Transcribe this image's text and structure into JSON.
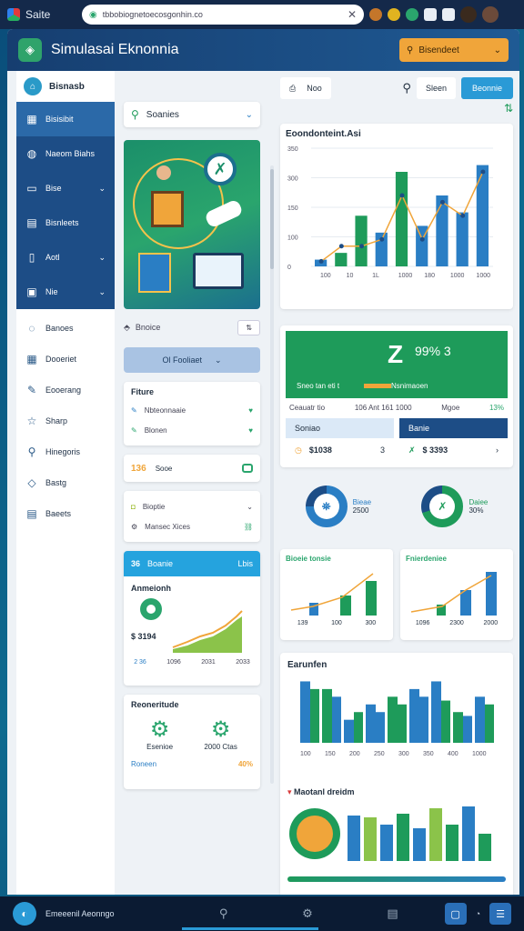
{
  "browser": {
    "brand": "Saite",
    "url": "tbbobiognetoecosgonhin.co",
    "close": "✕"
  },
  "app": {
    "title": "Simulasai Eknonnia",
    "header_select": "Bisendeet"
  },
  "sidebar": {
    "top_label": "Bisnasb",
    "items": [
      {
        "label": "Bisisibit",
        "icon": "chart-icon"
      },
      {
        "label": "Naeom Biahs",
        "icon": "globe-icon"
      },
      {
        "label": "Bise",
        "icon": "folder-icon"
      },
      {
        "label": "Bisnleets",
        "icon": "document-icon"
      },
      {
        "label": "Aotl",
        "icon": "file-icon"
      },
      {
        "label": "Nie",
        "icon": "image-icon"
      }
    ],
    "light_items": [
      {
        "label": "Banoes",
        "icon": "chat-icon"
      },
      {
        "label": "Dooeriet",
        "icon": "calendar-icon"
      },
      {
        "label": "Eooerang",
        "icon": "pencil-icon"
      },
      {
        "label": "Sharp",
        "icon": "star-icon"
      },
      {
        "label": "Hinegoris",
        "icon": "pin-icon"
      },
      {
        "label": "Bastg",
        "icon": "tag-icon"
      },
      {
        "label": "Baeets",
        "icon": "printer-icon"
      }
    ]
  },
  "col2": {
    "search_label": "Soanies",
    "row_label": "Bnoice",
    "row_select": "⇅",
    "button_label": "Ol Fooliaet",
    "feature_title": "Fiture",
    "feature_items": [
      "Nbteonnaaie",
      "Blonen"
    ],
    "score_value": "136",
    "score_label": "Sooe",
    "list_items": [
      "Bioptie",
      "Mansec Xices"
    ],
    "analytics_head_left": "36",
    "analytics_head_center": "Boanie",
    "analytics_head_right": "Lbis",
    "analytics_title": "Anmeionh",
    "analytics_value": "$ 3194",
    "analytics_ticks": [
      "2 36",
      "1096",
      "2031",
      "2033"
    ],
    "region_title": "Reoneritude",
    "region_items": [
      "Esenioe",
      "2000 Ctas"
    ],
    "region_footer": "Roneen",
    "region_pct": "40%"
  },
  "main": {
    "chip_label": "Noo",
    "search_chip": "Sleen",
    "primary_label": "Beonnie",
    "chart1_title": "Eoondonteint.Asi",
    "chart1_yticks": [
      "350",
      "300",
      "150",
      "100",
      "0"
    ],
    "chart1_xticks": [
      "100",
      "10",
      "1L",
      "1000",
      "180",
      "1000",
      "1000"
    ],
    "banner_big": "Z",
    "banner_small": "99% 3",
    "banner_cap": "Sneo tan eti t",
    "banner_cap2": "Nsnimaoen",
    "info_left": "Ceauatr tio",
    "info_mid": "106 Ant 161 1000",
    "info_right": "Mgoe",
    "info_pct": "13%",
    "box1_head": "Soniao",
    "box1_value": "$1038",
    "box1_count": "3",
    "box2_head": "Banie",
    "box2_value": "$ 3393",
    "donut1_label": "Bieae",
    "donut1_value": "2500",
    "donut2_label": "Daiee",
    "donut2_value": "30%",
    "mini1_title": "Bioeie tonsie",
    "mini1_ticks": [
      "139",
      "100",
      "300"
    ],
    "mini2_title": "Fnierdeniee",
    "mini2_ticks": [
      "1096",
      "2300",
      "2000"
    ],
    "chart2_title": "Earunfen",
    "chart2_xticks": [
      "100",
      "150",
      "200",
      "250",
      "300",
      "350",
      "400",
      "1000"
    ],
    "chart3_title": "Maotanl dreidm"
  },
  "bottombar": {
    "label": "Emeeenil Aeonngo",
    "icons": [
      "search-icon",
      "settings-icon",
      "document-icon"
    ]
  },
  "colors": {
    "navy": "#1d4d86",
    "green": "#1e9b5a",
    "blue": "#2a9ad6",
    "orange": "#f0a53a"
  },
  "chart_data": [
    {
      "type": "bar",
      "title": "Eoondonteint.Asi",
      "categories": [
        "100",
        "10",
        "1L",
        "1000",
        "180",
        "1000",
        "1000"
      ],
      "series": [
        {
          "values": [
            20,
            40,
            150,
            100,
            280,
            120,
            210,
            160,
            300
          ]
        },
        {
          "values": [
            15,
            60,
            60,
            80,
            210,
            80,
            190,
            150,
            280
          ]
        }
      ],
      "ylim": [
        0,
        350
      ]
    },
    {
      "type": "bar",
      "title": "Earunfen",
      "categories": [
        "100",
        "150",
        "200",
        "250",
        "300",
        "350",
        "400",
        "1000"
      ],
      "series": [
        {
          "values": [
            80,
            70,
            30,
            50,
            60,
            70,
            80,
            40,
            60
          ]
        },
        {
          "values": [
            70,
            60,
            40,
            40,
            50,
            60,
            55,
            35,
            50
          ]
        }
      ]
    }
  ]
}
